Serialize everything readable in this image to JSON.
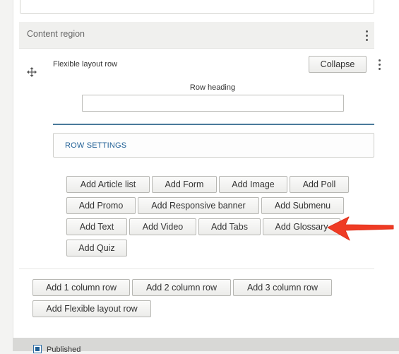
{
  "region": {
    "title": "Content region"
  },
  "row": {
    "label": "Flexible layout row",
    "collapse_label": "Collapse",
    "heading_label": "Row heading",
    "heading_value": "",
    "settings_label": "ROW SETTINGS"
  },
  "add_buttons": [
    "Add Article list",
    "Add Form",
    "Add Image",
    "Add Poll",
    "Add Promo",
    "Add Responsive banner",
    "Add Submenu",
    "Add Text",
    "Add Video",
    "Add Tabs",
    "Add Glossary",
    "Add Quiz"
  ],
  "row_buttons": [
    "Add 1 column row",
    "Add 2 column row",
    "Add 3 column row",
    "Add Flexible layout row"
  ],
  "footer": {
    "published_label": "Published",
    "published_checked": true
  },
  "colors": {
    "accent_link": "#1f5f95",
    "arrow": "#ef3b24"
  },
  "icons": {
    "drag": "move-arrows-icon",
    "menu": "kebab-menu-icon",
    "annotation": "red-arrow"
  }
}
